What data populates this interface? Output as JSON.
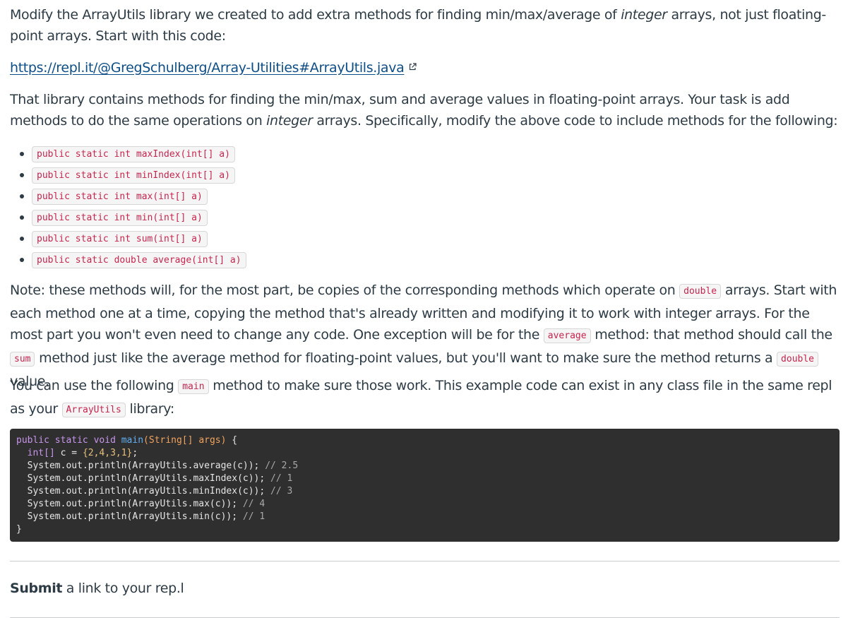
{
  "intro": {
    "before": "Modify the ArrayUtils library we created to add extra methods for finding min/max/average of ",
    "em": "integer",
    "after": " arrays, not just floating-point arrays. Start with this code:"
  },
  "link": {
    "text": "https://repl.it/@GregSchulberg/Array-Utilities#ArrayUtils.java",
    "icon": "external-link-icon"
  },
  "description": {
    "before": "That library contains methods for finding the min/max, sum and average values in floating-point arrays. Your task is add methods to do the same operations on ",
    "em": "integer",
    "after": " arrays. Specifically, modify the above code to include methods for the following:"
  },
  "methods": [
    "public static int maxIndex(int[] a)",
    "public static int minIndex(int[] a)",
    "public static int max(int[] a)",
    "public static int min(int[] a)",
    "public static int sum(int[] a)",
    "public static double average(int[] a)"
  ],
  "note": {
    "part1": "Note: these methods will, for the most part, be copies of the corresponding methods which operate on ",
    "code1": "double",
    "part2": " arrays. Start with each method one at a time, copying the method that's already written and modifying it to work with integer arrays. For the most part you won't even need to change any code. One exception will be for the ",
    "code2": "average",
    "part3": " method: that method should call the ",
    "code3": "sum",
    "part4": " method just like the average method for floating-point values, but you'll want to make sure the method returns a ",
    "code4": "double",
    "part5": " value."
  },
  "usage": {
    "part1": "You can use the following ",
    "code1": "main",
    "part2": " method to make sure those work. This example code can exist in any class file in the same repl as your ",
    "code2": "ArrayUtils",
    "part3": " library:"
  },
  "code_sample": {
    "sig_public": "public",
    "sig_static": "static",
    "sig_void": "void",
    "sig_name": "main",
    "sig_params": "(String[] args)",
    "sig_brace": " {",
    "decl_type": "int[]",
    "decl_var": " c = ",
    "decl_vals": "{2,4,3,1}",
    "decl_end": ";",
    "lines": [
      {
        "stmt": "System.out.println(ArrayUtils.average(c)); ",
        "comment": "// 2.5"
      },
      {
        "stmt": "System.out.println(ArrayUtils.maxIndex(c)); ",
        "comment": "// 1"
      },
      {
        "stmt": "System.out.println(ArrayUtils.minIndex(c)); ",
        "comment": "// 3"
      },
      {
        "stmt": "System.out.println(ArrayUtils.max(c)); ",
        "comment": "// 4"
      },
      {
        "stmt": "System.out.println(ArrayUtils.min(c)); ",
        "comment": "// 1"
      }
    ],
    "closing": "}"
  },
  "submit": {
    "bold": "Submit",
    "rest": " a link to your rep.l"
  }
}
